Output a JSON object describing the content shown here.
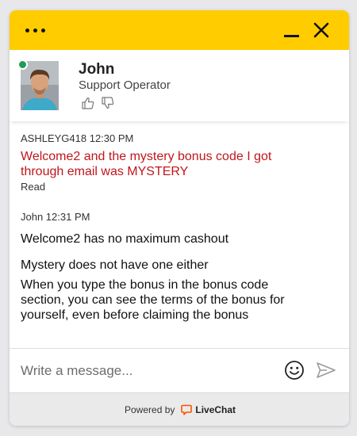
{
  "header": {
    "menu_icon": "more-dots-icon",
    "minimize_icon": "minimize-icon",
    "close_icon": "close-icon",
    "bar_color": "#ffcc00"
  },
  "agent": {
    "name": "John",
    "role": "Support Operator",
    "status_color": "#1f9d55",
    "rate_up_icon": "thumbs-up-icon",
    "rate_down_icon": "thumbs-down-icon"
  },
  "messages": [
    {
      "meta": "ASHLEYG418 12:30 PM",
      "text": "Welcome2 and the mystery bonus code I got through email was MYSTERY",
      "status": "Read",
      "color": "#c0161b"
    },
    {
      "meta": "John 12:31 PM",
      "lines": [
        "Welcome2 has no maximum cashout",
        "Mystery does not have one either",
        "When you type the bonus in the bonus code section, you can see the terms of the bonus for yourself, even before claiming the bonus"
      ]
    }
  ],
  "composer": {
    "placeholder": "Write a message...",
    "value": "",
    "emoji_icon": "emoji-icon",
    "send_icon": "send-icon"
  },
  "footer": {
    "powered_by": "Powered by",
    "brand": "LiveChat",
    "brand_color": "#ff5100"
  }
}
